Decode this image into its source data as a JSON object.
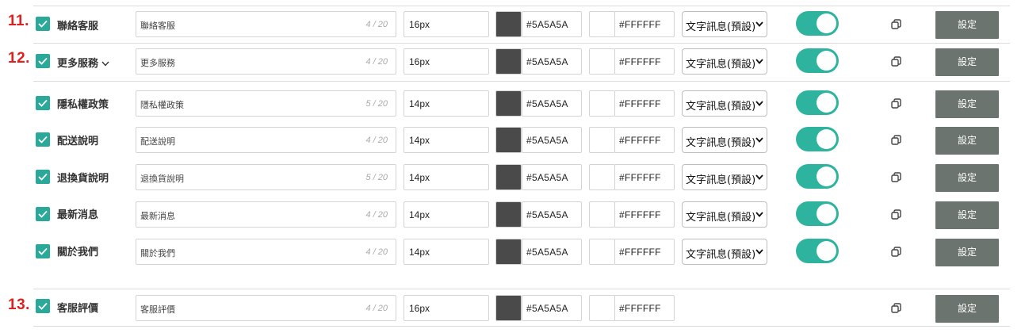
{
  "rows": [
    {
      "num": "11.",
      "label": "聯絡客服",
      "name": "聯絡客服",
      "count": "4 / 20",
      "size": "16px",
      "color1": "#5A5A5A",
      "color2": "#FFFFFF",
      "select": "文字訊息(預設)",
      "button": "設定"
    },
    {
      "num": "12.",
      "label": "更多服務",
      "name": "更多服務",
      "count": "4 / 20",
      "size": "16px",
      "color1": "#5A5A5A",
      "color2": "#FFFFFF",
      "select": "文字訊息(預設)",
      "button": "設定"
    },
    {
      "label": "隱私權政策",
      "name": "隱私權政策",
      "count": "5 / 20",
      "size": "14px",
      "color1": "#5A5A5A",
      "color2": "#FFFFFF",
      "select": "文字訊息(預設)",
      "button": "設定"
    },
    {
      "label": "配送說明",
      "name": "配送說明",
      "count": "4 / 20",
      "size": "14px",
      "color1": "#5A5A5A",
      "color2": "#FFFFFF",
      "select": "文字訊息(預設)",
      "button": "設定"
    },
    {
      "label": "退換貨說明",
      "name": "退換貨說明",
      "count": "5 / 20",
      "size": "14px",
      "color1": "#5A5A5A",
      "color2": "#FFFFFF",
      "select": "文字訊息(預設)",
      "button": "設定"
    },
    {
      "label": "最新消息",
      "name": "最新消息",
      "count": "4 / 20",
      "size": "14px",
      "color1": "#5A5A5A",
      "color2": "#FFFFFF",
      "select": "文字訊息(預設)",
      "button": "設定"
    },
    {
      "label": "關於我們",
      "name": "關於我們",
      "count": "4 / 20",
      "size": "14px",
      "color1": "#5A5A5A",
      "color2": "#FFFFFF",
      "select": "文字訊息(預設)",
      "button": "設定"
    },
    {
      "num": "13.",
      "label": "客服評價",
      "name": "客服評價",
      "count": "4 / 20",
      "size": "16px",
      "color1": "#5A5A5A",
      "color2": "#FFFFFF",
      "button": "設定"
    }
  ],
  "colors": {
    "accent": "#2aa89a",
    "toggle_on": "#2eb49e",
    "swatch_dark": "#4a4a4a",
    "swatch_light": "#ffffff",
    "button_bg": "#6b746e",
    "step_number": "#e02020"
  },
  "icons": {
    "checkbox": "check-icon",
    "expand": "chevron-down-icon",
    "copy": "copy-icon",
    "select": "select-arrow-icon"
  }
}
